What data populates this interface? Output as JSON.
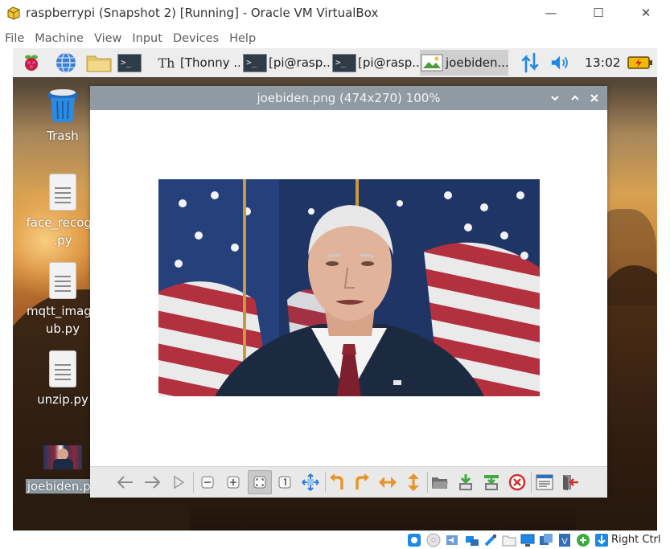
{
  "window": {
    "title": "raspberrypi (Snapshot 2) [Running] - Oracle VM VirtualBox",
    "minimize_glyph": "—",
    "maximize_glyph": "☐",
    "close_glyph": "✕"
  },
  "menu": [
    "File",
    "Machine",
    "View",
    "Input",
    "Devices",
    "Help"
  ],
  "panel": {
    "launchers": [
      "raspberry-menu-icon",
      "web-browser-icon",
      "file-manager-icon",
      "terminal-icon"
    ],
    "tasks": [
      {
        "label": "[Thonny ..."
      },
      {
        "label": "[pi@rasp..."
      },
      {
        "label": "[pi@rasp..."
      },
      {
        "label": "joebiden..."
      }
    ],
    "term_glyph": ">_",
    "thonny_glyph": "Th",
    "clock": "13:02"
  },
  "desktop": {
    "icons": [
      {
        "label": "Trash"
      },
      {
        "label": "face_recogn .py"
      },
      {
        "label": "mqtt_image ub.py"
      },
      {
        "label": "unzip.py"
      },
      {
        "label": "joebiden.pn"
      }
    ]
  },
  "viewer": {
    "title": "joebiden.png (474x270) 100%",
    "tools": [
      "previous-icon",
      "next-icon",
      "play-slideshow-icon",
      "zoom-out-icon",
      "zoom-in-icon",
      "fit-window-icon",
      "original-size-icon",
      "fullscreen-icon",
      "rotate-left-icon",
      "rotate-right-icon",
      "flip-horizontal-icon",
      "flip-vertical-icon",
      "open-file-icon",
      "save-icon",
      "save-as-icon",
      "delete-icon",
      "preferences-icon",
      "quit-icon"
    ]
  },
  "status": {
    "host_key": "Right Ctrl"
  },
  "colors": {
    "viewer_titlebar": "#8f9aa3",
    "panel": "#ededed",
    "battery": "#f5b800",
    "orange_tool": "#e8942a"
  }
}
